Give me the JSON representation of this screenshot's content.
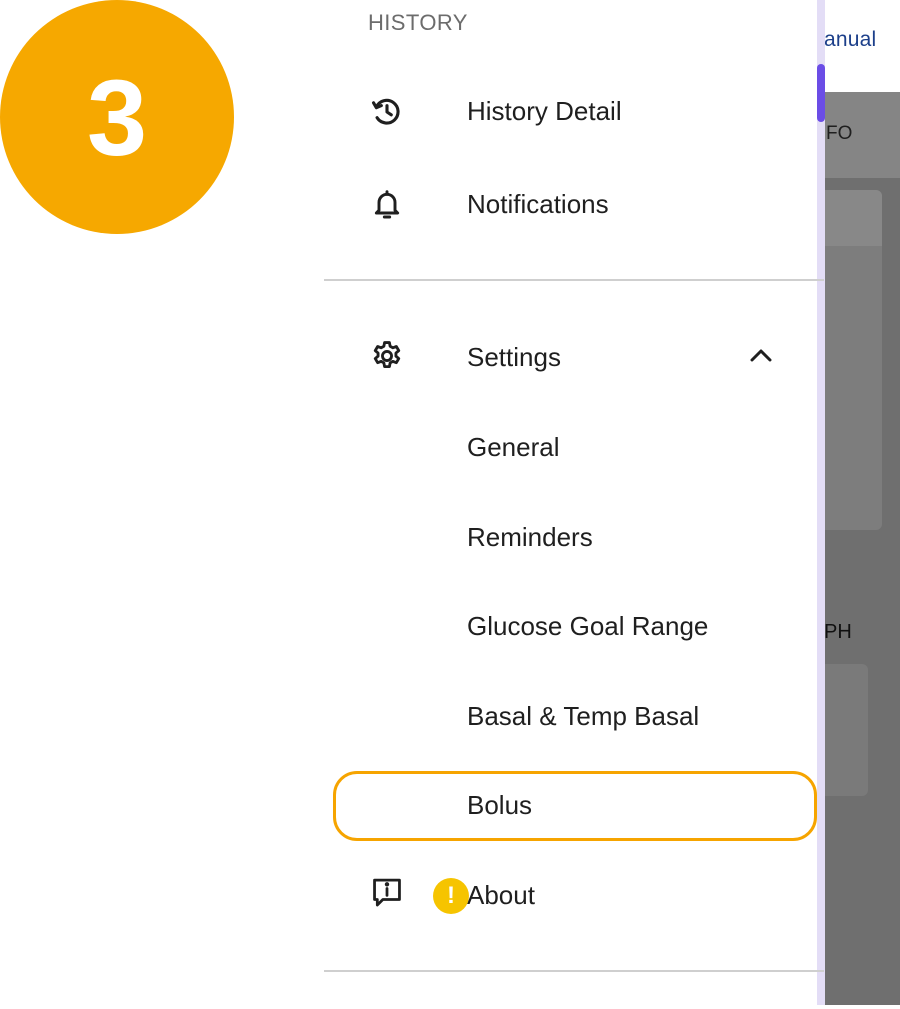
{
  "step_badge": {
    "number": "3",
    "color": "#f6a800"
  },
  "background_app": {
    "topbar_text": "anual",
    "tab_text": "FO",
    "section_text": "PH",
    "accent_color": "#6b4de6"
  },
  "drawer": {
    "section_header": "HISTORY",
    "items": [
      {
        "label": "History Detail",
        "icon": "history-icon"
      },
      {
        "label": "Notifications",
        "icon": "bell-icon"
      },
      {
        "label": "Settings",
        "icon": "gear-icon",
        "expanded": true,
        "chevron": "chevron-up-icon"
      },
      {
        "label": "General"
      },
      {
        "label": "Reminders"
      },
      {
        "label": "Glucose Goal Range"
      },
      {
        "label": "Basal & Temp Basal"
      },
      {
        "label": "Bolus",
        "highlighted": true
      },
      {
        "label": "About",
        "icon": "info-icon",
        "badge": "!"
      }
    ]
  },
  "highlight_color": "#f6a400"
}
